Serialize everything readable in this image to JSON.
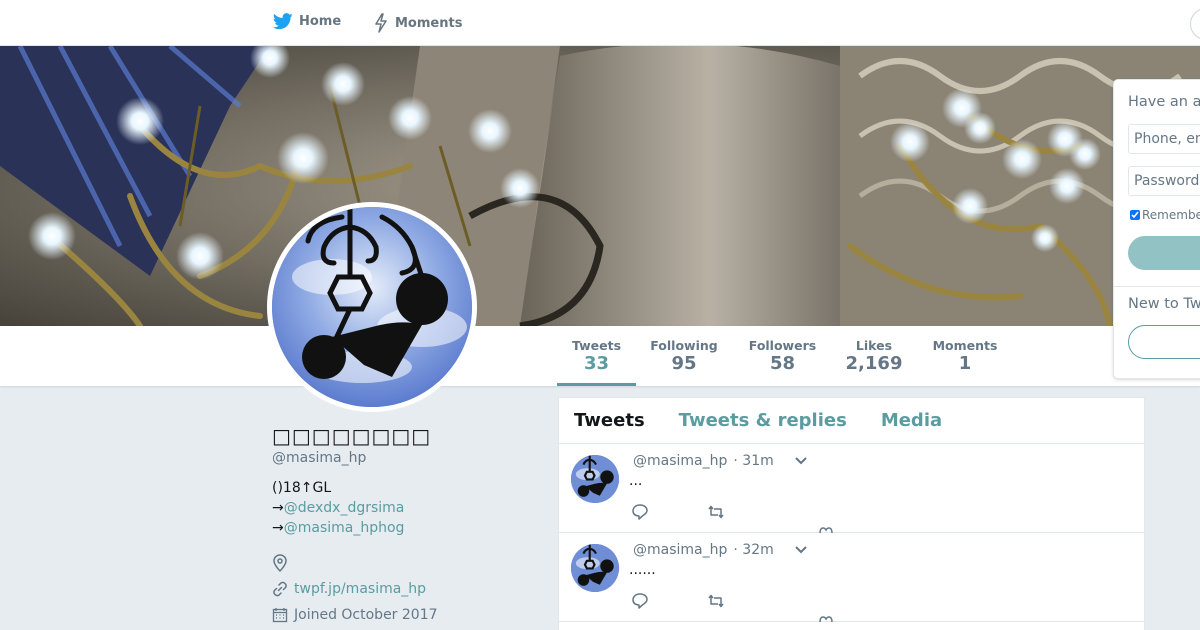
{
  "nav": {
    "home_label": "Home",
    "moments_label": "Moments"
  },
  "profile": {
    "name": "□□□□□□□□",
    "handle": "@masima_hp",
    "bio_line1": "()18↑GL",
    "bio_arrow1": "→",
    "bio_link1": "@dexdx_dgrsima",
    "bio_arrow2": "→",
    "bio_link2": "@masima_hphog",
    "url": "twpf.jp/masima_hp",
    "joined": "Joined October 2017"
  },
  "stats": [
    {
      "label": "Tweets",
      "value": "33"
    },
    {
      "label": "Following",
      "value": "95"
    },
    {
      "label": "Followers",
      "value": "58"
    },
    {
      "label": "Likes",
      "value": "2,169"
    },
    {
      "label": "Moments",
      "value": "1"
    }
  ],
  "tabs": [
    {
      "label": "Tweets"
    },
    {
      "label": "Tweets & replies"
    },
    {
      "label": "Media"
    }
  ],
  "tweets": [
    {
      "handle": "@masima_hp",
      "time": "· 31m",
      "text": "..."
    },
    {
      "handle": "@masima_hp",
      "time": "· 32m",
      "text": "......"
    }
  ],
  "login": {
    "heading": "Have an account?",
    "phone_placeholder": "Phone, email or username",
    "password_placeholder": "Password",
    "remember_label": "Remember me",
    "new_heading": "New to Twitter?"
  },
  "colors": {
    "accent": "#5a9ca0",
    "accent_light": "#92c2c4",
    "background": "#e6ecf0",
    "secondary_text": "#657786",
    "twitter_blue": "#1da1f2"
  },
  "icons": {
    "home": "twitter-bird-icon",
    "moments": "lightning-icon",
    "location": "location-pin-icon",
    "url": "link-icon",
    "joined": "calendar-icon",
    "reply": "reply-icon",
    "retweet": "retweet-icon",
    "like": "heart-icon",
    "menu": "chevron-down-icon"
  }
}
